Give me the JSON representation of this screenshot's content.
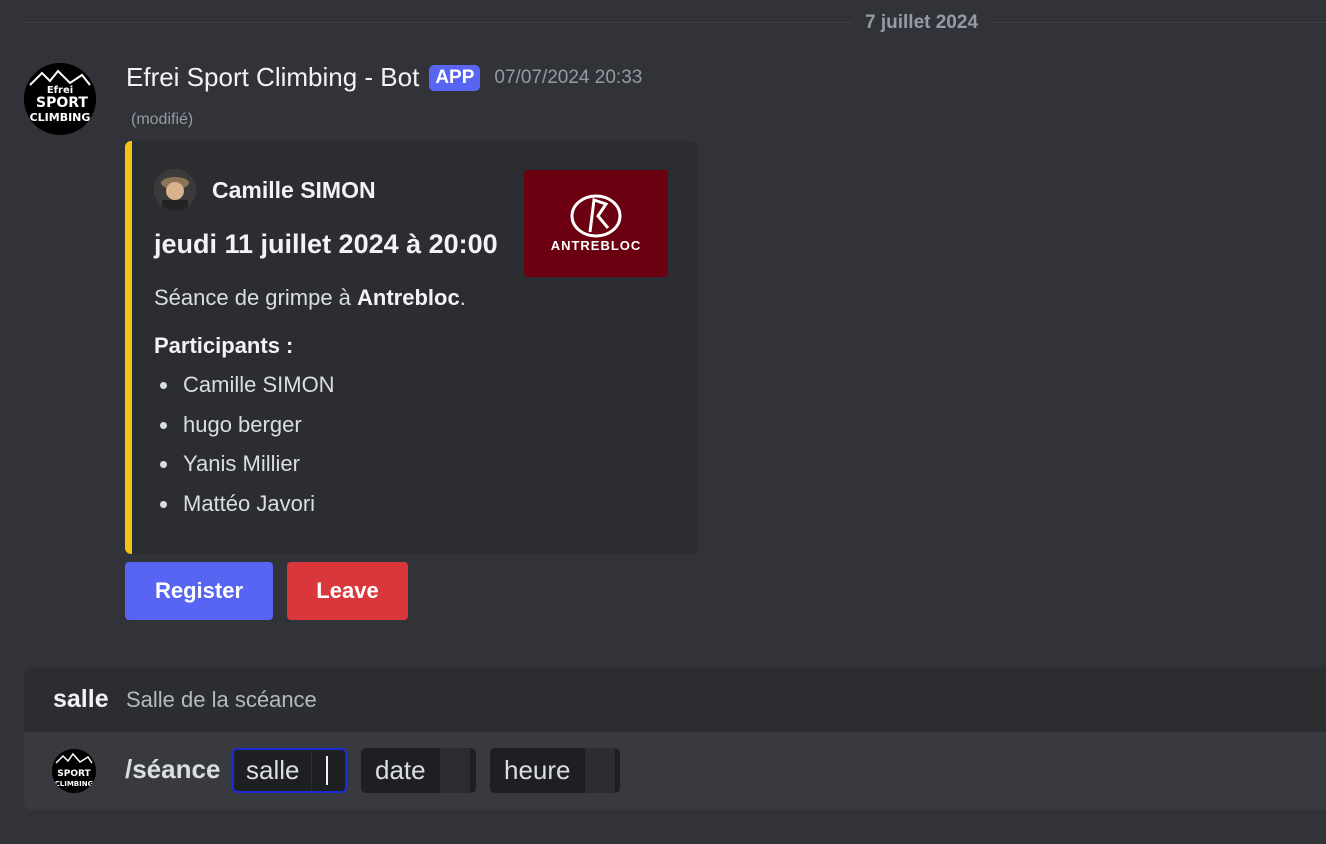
{
  "date_divider": "7 juillet 2024",
  "message": {
    "author": "Efrei Sport Climbing - Bot",
    "badge": "APP",
    "timestamp": "07/07/2024 20:33",
    "edited": "(modifié)",
    "avatar_text": [
      "Efrei",
      "SPORT",
      "CLIMBING"
    ]
  },
  "embed": {
    "accent_color": "#f0c419",
    "author_name": "Camille SIMON",
    "title": "jeudi 11 juillet 2024 à 20:00",
    "description_prefix": "Séance de grimpe à ",
    "description_bold": "Antrebloc",
    "description_suffix": ".",
    "field_name": "Participants :",
    "participants": [
      "Camille SIMON",
      "hugo berger",
      "Yanis Millier",
      "Mattéo Javori"
    ],
    "thumbnail_text": "ANTREBLOC"
  },
  "buttons": {
    "register": "Register",
    "leave": "Leave"
  },
  "autocomplete": {
    "option_name": "salle",
    "option_description": "Salle de la scéance"
  },
  "composer": {
    "command": "/séance",
    "options": [
      "salle",
      "date",
      "heure"
    ]
  },
  "colors": {
    "background": "#313338",
    "blurple": "#5865f2",
    "danger": "#da373c"
  }
}
